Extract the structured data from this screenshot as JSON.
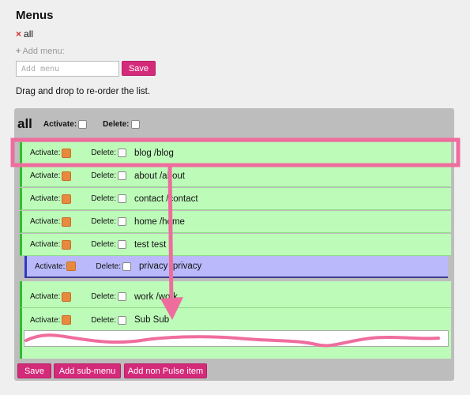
{
  "page": {
    "title": "Menus",
    "current_menu": "all",
    "remove_symbol": "×",
    "add_menu_label": "Add menu:",
    "add_menu_placeholder": "Add menu",
    "save_label": "Save",
    "instructions": "Drag and drop to re-order the list."
  },
  "root": {
    "title": "all",
    "activate_label": "Activate:",
    "delete_label": "Delete:"
  },
  "items": [
    {
      "name": "blog /blog"
    },
    {
      "name": "about /about"
    },
    {
      "name": "contact /contact"
    },
    {
      "name": "home /home"
    },
    {
      "name": "test test"
    },
    {
      "name": "privacy /privacy"
    },
    {
      "name": "work /work"
    },
    {
      "name": "Sub Sub"
    }
  ],
  "footer": {
    "save_label": "Save",
    "add_sub_menu_label": "Add sub-menu",
    "add_non_pulse_label": "Add non Pulse item"
  },
  "colors": {
    "accent": "#d42a7a",
    "item_bg": "#bdfbb9",
    "sub_item_bg": "#b9b9fb",
    "annotation": "#ef6d9d"
  }
}
